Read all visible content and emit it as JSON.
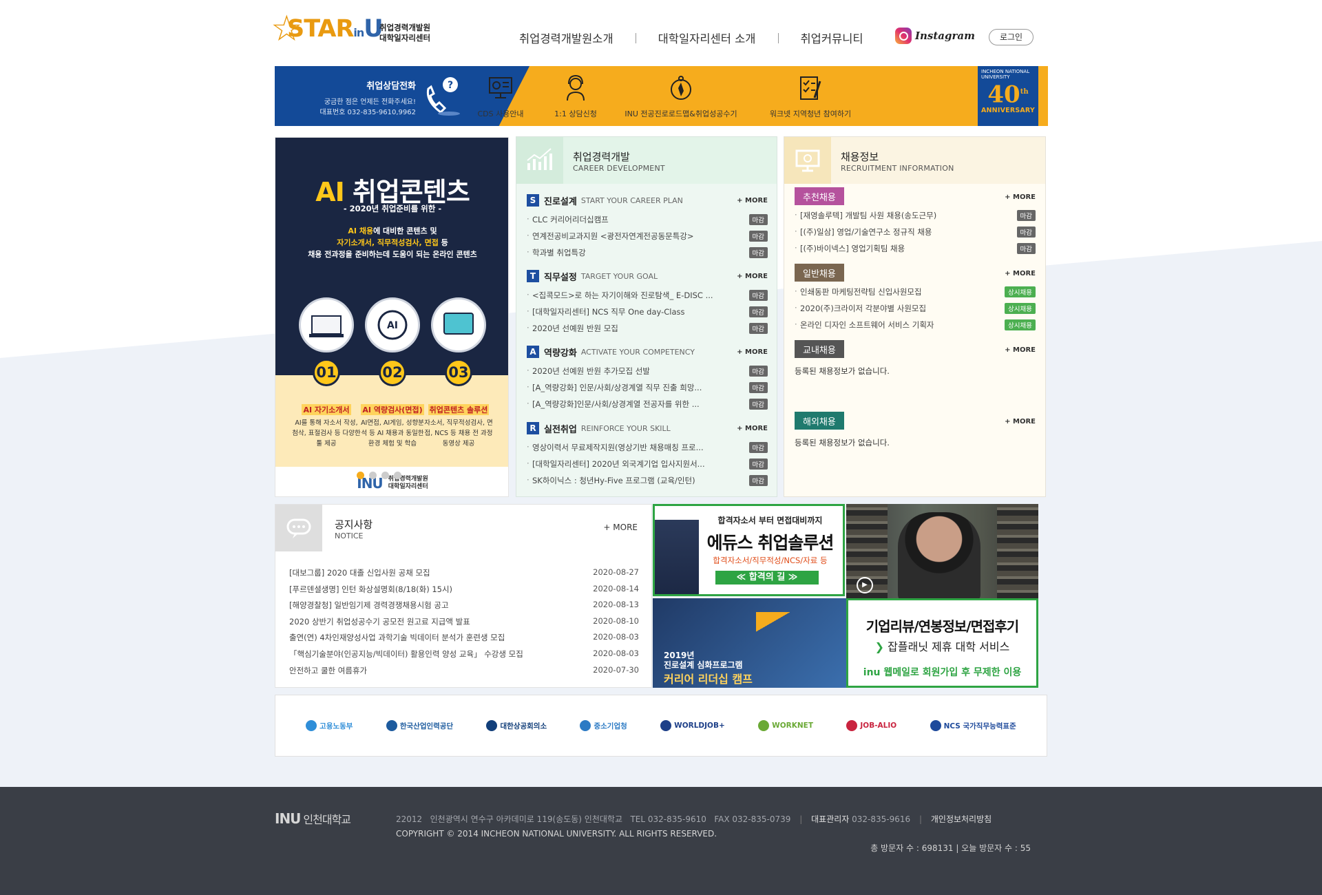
{
  "header": {
    "logo_main": "STAR",
    "logo_in": "in",
    "logo_u": "U",
    "logo_sub1": "취업경력개발원",
    "logo_sub2": "대학일자리센터",
    "nav": [
      "취업경력개발원소개",
      "대학일자리센터 소개",
      "취업커뮤니티"
    ],
    "instagram": "Instagram",
    "login": "로그인"
  },
  "banner": {
    "tel_title": "취업상담전화",
    "tel_desc": "궁금한 점은 언제든 전화주세요!",
    "tel_number": "대표번호 032-835-9610,9962",
    "quick_links": [
      "CDS 사용안내",
      "1:1 상담신청",
      "INU 전공진로로드맵&취업성공수기",
      "워크넷 지역청년 참여하기"
    ],
    "anniv_top": "INCHEON NATIONAL UNIVERSITY",
    "anniv_num": "40",
    "anniv_sup": "th",
    "anniv_label": "ANNIVERSARY"
  },
  "promo": {
    "pre": "- 2020년 취업준비를 위한 -",
    "title_ai": "AI",
    "title_rest": " 취업콘텐츠",
    "desc1_y": "AI 채용",
    "desc1_w": "에 대비한 콘텐츠 및",
    "desc2_y": "자기소개서, 직무적성검사, 면접",
    "desc2_w": " 등",
    "desc3": "채용 전과정을 준비하는데 도움이 되는 온라인 콘텐츠",
    "nums": [
      "01",
      "02",
      "03"
    ],
    "cols": [
      {
        "h": "AI 자기소개서",
        "d": "AI를 통해 자소서 작성, 첨삭, 표절검사 등 다양한 툴 제공"
      },
      {
        "h": "AI 역량검사(면접)",
        "d": "AI면접, AI게임, 성향분석 등 AI 채용과 동일한 환경 체험 및 학습"
      },
      {
        "h": "취업콘텐츠 솔루션",
        "d": "자소서, 직무적성검사, 면접, NCS 등 채용 전 과정 동영상 제공"
      }
    ],
    "foot_logo": "INU",
    "foot_sub1": "취업경력개발원",
    "foot_sub2": "대학일자리센터"
  },
  "career": {
    "title": "취업경력개발",
    "title_en": "CAREER DEVELOPMENT",
    "more": "+ MORE",
    "sections": [
      {
        "letter": "S",
        "title": "진로설계",
        "en": "START YOUR CAREER PLAN",
        "items": [
          "CLC 커리어리더십캠프",
          "연계전공비교과지원 <광전자연계전공동문특강>",
          "학과별 취업특강"
        ],
        "tags": [
          "마감",
          "마감",
          "마감"
        ]
      },
      {
        "letter": "T",
        "title": "직무설정",
        "en": "TARGET YOUR GOAL",
        "items": [
          "<집콕모드>로 하는 자기이해와 진로탐색_ E-DISC ...",
          "[대학일자리센터] NCS 직무 One day-Class",
          "2020년 선예원 반원 모집"
        ],
        "tags": [
          "마감",
          "마감",
          "마감"
        ]
      },
      {
        "letter": "A",
        "title": "역량강화",
        "en": "ACTIVATE YOUR COMPETENCY",
        "items": [
          "2020년 선예원 반원 추가모집 선발",
          "[A_역량강화] 인문/사회/상경계열 직무 진출 희망...",
          "[A_역량강화]인문/사회/상경계열 전공자를 위한 ..."
        ],
        "tags": [
          "마감",
          "마감",
          "마감"
        ]
      },
      {
        "letter": "R",
        "title": "실전취업",
        "en": "REINFORCE YOUR SKILL",
        "items": [
          "영상이력서 무료제작지원(영상기반 채용매칭 프로...",
          "[대학일자리센터] 2020년 외국계기업 입사지원서...",
          "SK하이닉스 : 청년Hy-Five 프로그램 (교육/인턴)"
        ],
        "tags": [
          "마감",
          "마감",
          "마감"
        ]
      }
    ]
  },
  "recruit": {
    "title": "채용정보",
    "title_en": "RECRUITMENT INFORMATION",
    "more": "+ MORE",
    "sections": [
      {
        "label": "추천채용",
        "color": "#b5529d",
        "items": [
          "[재영솔루텍] 개발팀 사원 채용(송도근무)",
          "[(주)일삼] 영업/기술연구소 정규직 채용",
          "[(주)바이넥스] 영업기획팀 채용"
        ],
        "tags": [
          "마감",
          "마감",
          "마감"
        ],
        "empty": ""
      },
      {
        "label": "일반채용",
        "color": "#7a6650",
        "items": [
          "인쇄동판 마케팅전략팀 신입사원모집",
          "2020(주)크라이저 각분야별 사원모집",
          "온라인 디자인 소프트웨어 서비스 기획자"
        ],
        "tags": [
          "상시채용",
          "상시채용",
          "상시채용"
        ],
        "empty": ""
      },
      {
        "label": "교내채용",
        "color": "#555555",
        "items": [],
        "tags": [],
        "empty": "등록된 채용정보가 없습니다."
      },
      {
        "label": "해외채용",
        "color": "#1f7a6e",
        "items": [],
        "tags": [],
        "empty": "등록된 채용정보가 없습니다."
      }
    ]
  },
  "notice": {
    "title": "공지사항",
    "title_en": "NOTICE",
    "more": "+ MORE",
    "items": [
      {
        "t": "[대보그룹] 2020 대졸 신입사원 공채 모집",
        "d": "2020-08-27"
      },
      {
        "t": "[푸르덴셜생명] 인턴 화상설명회(8/18(화) 15시)",
        "d": "2020-08-14"
      },
      {
        "t": "[해양경찰청] 일반임기제 경력경쟁채용시험 공고",
        "d": "2020-08-13"
      },
      {
        "t": "2020 상반기 취업성공수기 공모전 원고료 지급액 발표",
        "d": "2020-08-10"
      },
      {
        "t": "출연(연) 4차인재양성사업 과학기술 빅데이터 분석가 훈련생 모집",
        "d": "2020-08-03"
      },
      {
        "t": "「핵심기술분야(인공지능/빅데이터) 활용인력 양성 교육」 수강생 모집",
        "d": "2020-08-03"
      },
      {
        "t": "안전하고 쿨한 여름휴가",
        "d": "2020-07-30"
      }
    ]
  },
  "ads": {
    "t1_a": "합격자소서 부터 면접대비까지",
    "t1_b": "에듀스 취업솔루션",
    "t1_c": "합격자소서/직무적성/NCS/자료 등",
    "t1_d": "≪ 합격의 길 ≫",
    "t3_a1": "2019년",
    "t3_a2": "진로설계 심화프로그램",
    "t3_b": "커리어 리더십 캠프",
    "t4_a": "기업리뷰/연봉정보/면접후기",
    "t4_arrow": "❯",
    "t4_b": "잡플래닛 제휴 대학 서비스",
    "t4_c": "inu 웹메일로 회원가입 후 무제한 이용"
  },
  "family": [
    {
      "n": "고용노동부",
      "c": "#2f8ed8"
    },
    {
      "n": "한국산업인력공단",
      "c": "#1d5b9e"
    },
    {
      "n": "대한상공회의소",
      "c": "#123f7a"
    },
    {
      "n": "중소기업청",
      "c": "#2b7ac4"
    },
    {
      "n": "WORLDJOB+",
      "c": "#1d3f88"
    },
    {
      "n": "WORKNET",
      "c": "#6aa935"
    },
    {
      "n": "JOB-ALIO",
      "c": "#c9243f"
    },
    {
      "n": "NCS 국가직무능력표준",
      "c": "#1e4a9b"
    }
  ],
  "footer": {
    "logo": "INU",
    "logo_ko": "인천대학교",
    "zip": "22012",
    "addr": "인천광역시 연수구 아카데미로 119(송도동) 인천대학교",
    "tel": "TEL 032-835-9610",
    "fax": "FAX 032-835-0739",
    "admin_label": "대표관리자",
    "admin_tel": "032-835-9616",
    "privacy": "개인정보처리방침",
    "copyright": "COPYRIGHT © 2014 INCHEON NATIONAL UNIVERSITY. ALL RIGHTS RESERVED.",
    "visitors": "총 방문자 수 : 698131 | 오늘 방문자 수 : 55"
  }
}
